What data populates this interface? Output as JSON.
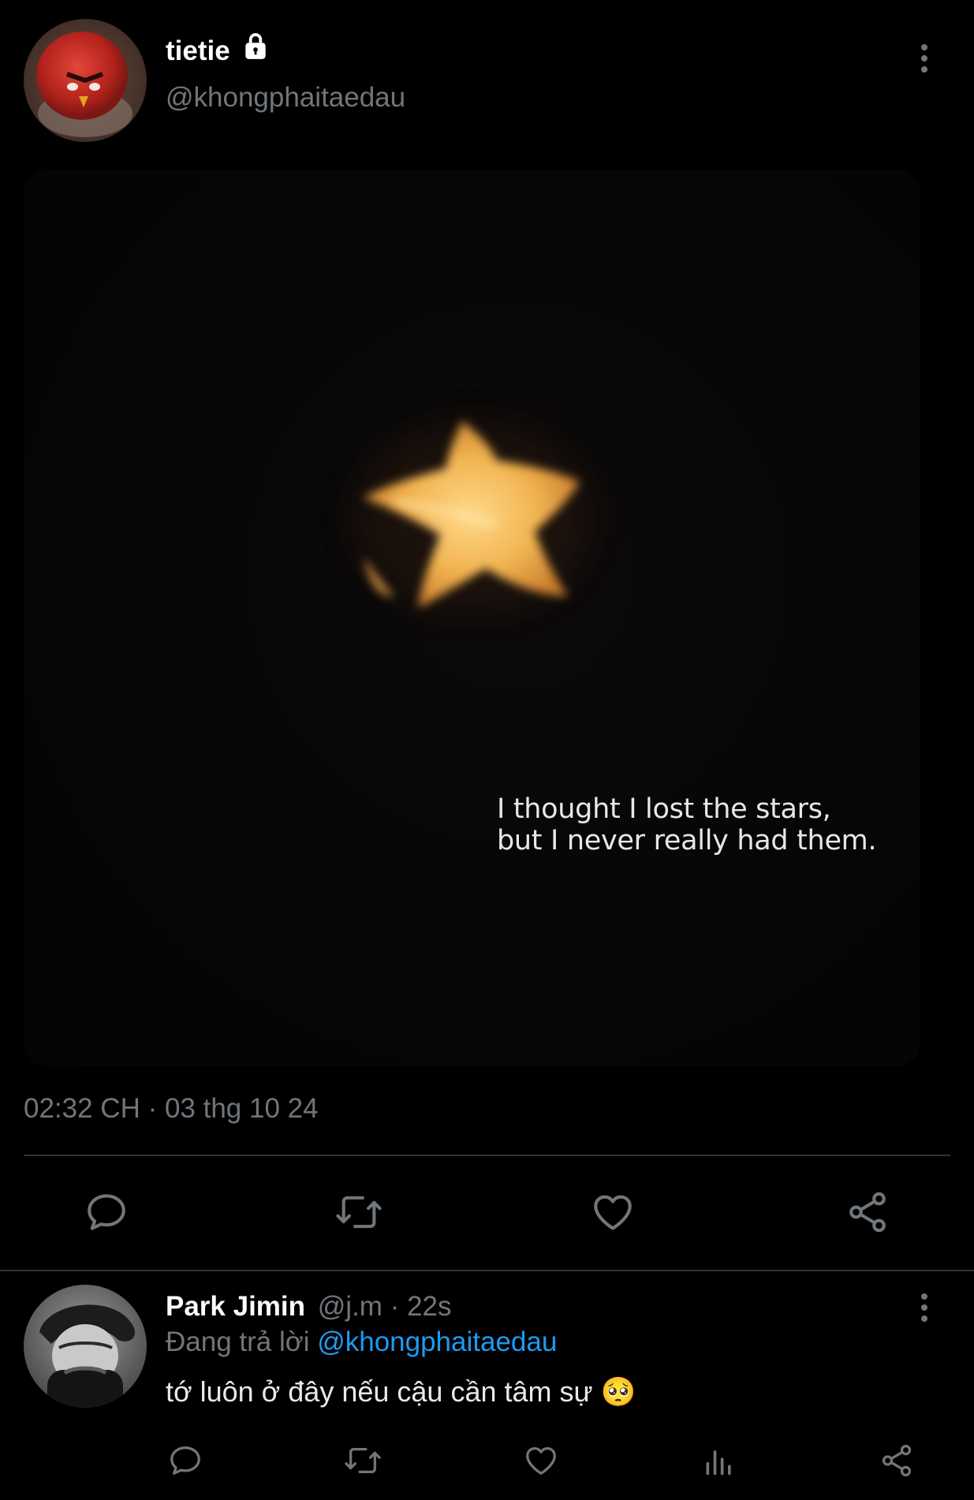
{
  "tweet": {
    "display_name": "tietie",
    "locked_icon": "lock-icon",
    "handle": "@khongphaitaedau",
    "media_caption_line1": "I thought I lost the stars,",
    "media_caption_line2": "but I never really had them.",
    "timestamp": "02:32 CH · 03 thg 10 24",
    "actions": [
      "reply-icon",
      "retweet-icon",
      "like-icon",
      "share-icon"
    ]
  },
  "reply": {
    "display_name": "Park Jimin",
    "handle_time": "@j.m · 22s",
    "replying_prefix": "Đang trả lời",
    "replying_mention": "@khongphaitaedau",
    "text": "tớ luôn ở đây nếu cậu cần tâm sự",
    "emoji": "🥺",
    "actions": [
      "reply-icon",
      "retweet-icon",
      "like-icon",
      "views-icon",
      "share-icon"
    ]
  },
  "colors": {
    "background": "#000000",
    "text": "#e7e9ea",
    "muted": "#71767b",
    "link": "#1d9bf0",
    "divider": "#2f3336"
  }
}
